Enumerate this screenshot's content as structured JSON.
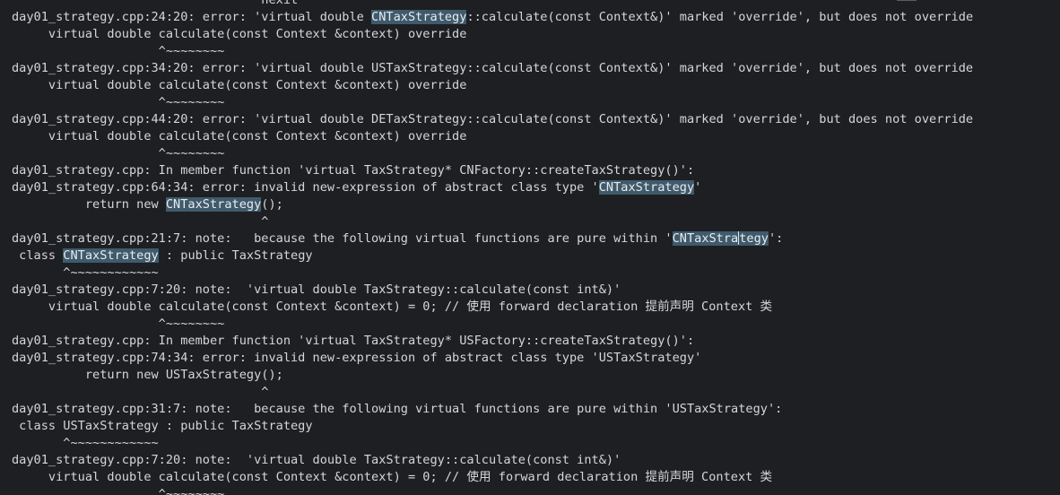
{
  "terminal": {
    "lines": [
      [
        {
          "t": "                                 ^nexit"
        }
      ],
      [
        {
          "t": "day01_strategy.cpp:24:20: error: 'virtual double "
        },
        {
          "t": "CNTaxStrategy",
          "h": true
        },
        {
          "t": "::calculate(const Context&)' marked 'override', but does not override"
        }
      ],
      [
        {
          "t": "     virtual double calculate(const Context &context) override"
        }
      ],
      [
        {
          "t": "                    ^~~~~~~~~"
        }
      ],
      [
        {
          "t": "day01_strategy.cpp:34:20: error: 'virtual double USTaxStrategy::calculate(const Context&)' marked 'override', but does not override"
        }
      ],
      [
        {
          "t": "     virtual double calculate(const Context &context) override"
        }
      ],
      [
        {
          "t": "                    ^~~~~~~~~"
        }
      ],
      [
        {
          "t": "day01_strategy.cpp:44:20: error: 'virtual double DETaxStrategy::calculate(const Context&)' marked 'override', but does not override"
        }
      ],
      [
        {
          "t": "     virtual double calculate(const Context &context) override"
        }
      ],
      [
        {
          "t": "                    ^~~~~~~~~"
        }
      ],
      [
        {
          "t": "day01_strategy.cpp: In member function 'virtual TaxStrategy* CNFactory::createTaxStrategy()':"
        }
      ],
      [
        {
          "t": "day01_strategy.cpp:64:34: error: invalid new-expression of abstract class type '"
        },
        {
          "t": "CNTaxStrategy",
          "h": true
        },
        {
          "t": "'"
        }
      ],
      [
        {
          "t": "          return new "
        },
        {
          "t": "CNTaxStrategy",
          "h": true
        },
        {
          "t": "();"
        }
      ],
      [
        {
          "t": "                                  ^"
        }
      ],
      [
        {
          "t": "day01_strategy.cpp:21:7: note:   because the following virtual functions are pure within '"
        },
        {
          "t": "CNTaxStra",
          "h": true
        },
        {
          "c": true
        },
        {
          "t": "tegy",
          "h": true
        },
        {
          "t": "':"
        }
      ],
      [
        {
          "t": " class "
        },
        {
          "t": "CNTaxStrategy",
          "h": true
        },
        {
          "t": " : public TaxStrategy"
        }
      ],
      [
        {
          "t": "       ^~~~~~~~~~~~~"
        }
      ],
      [
        {
          "t": "day01_strategy.cpp:7:20: note:  'virtual double TaxStrategy::calculate(const int&)'"
        }
      ],
      [
        {
          "t": "     virtual double calculate(const Context &context) = 0; // 使用 forward declaration 提前声明 Context 类"
        }
      ],
      [
        {
          "t": "                    ^~~~~~~~~"
        }
      ],
      [
        {
          "t": "day01_strategy.cpp: In member function 'virtual TaxStrategy* USFactory::createTaxStrategy()':"
        }
      ],
      [
        {
          "t": "day01_strategy.cpp:74:34: error: invalid new-expression of abstract class type 'USTaxStrategy'"
        }
      ],
      [
        {
          "t": "          return new USTaxStrategy();"
        }
      ],
      [
        {
          "t": "                                  ^"
        }
      ],
      [
        {
          "t": "day01_strategy.cpp:31:7: note:   because the following virtual functions are pure within 'USTaxStrategy':"
        }
      ],
      [
        {
          "t": " class USTaxStrategy : public TaxStrategy"
        }
      ],
      [
        {
          "t": "       ^~~~~~~~~~~~~"
        }
      ],
      [
        {
          "t": "day01_strategy.cpp:7:20: note:  'virtual double TaxStrategy::calculate(const int&)'"
        }
      ],
      [
        {
          "t": "     virtual double calculate(const Context &context) = 0; // 使用 forward declaration 提前声明 Context 类"
        }
      ],
      [
        {
          "t": "                    ^~~~~~~~~"
        }
      ]
    ]
  }
}
